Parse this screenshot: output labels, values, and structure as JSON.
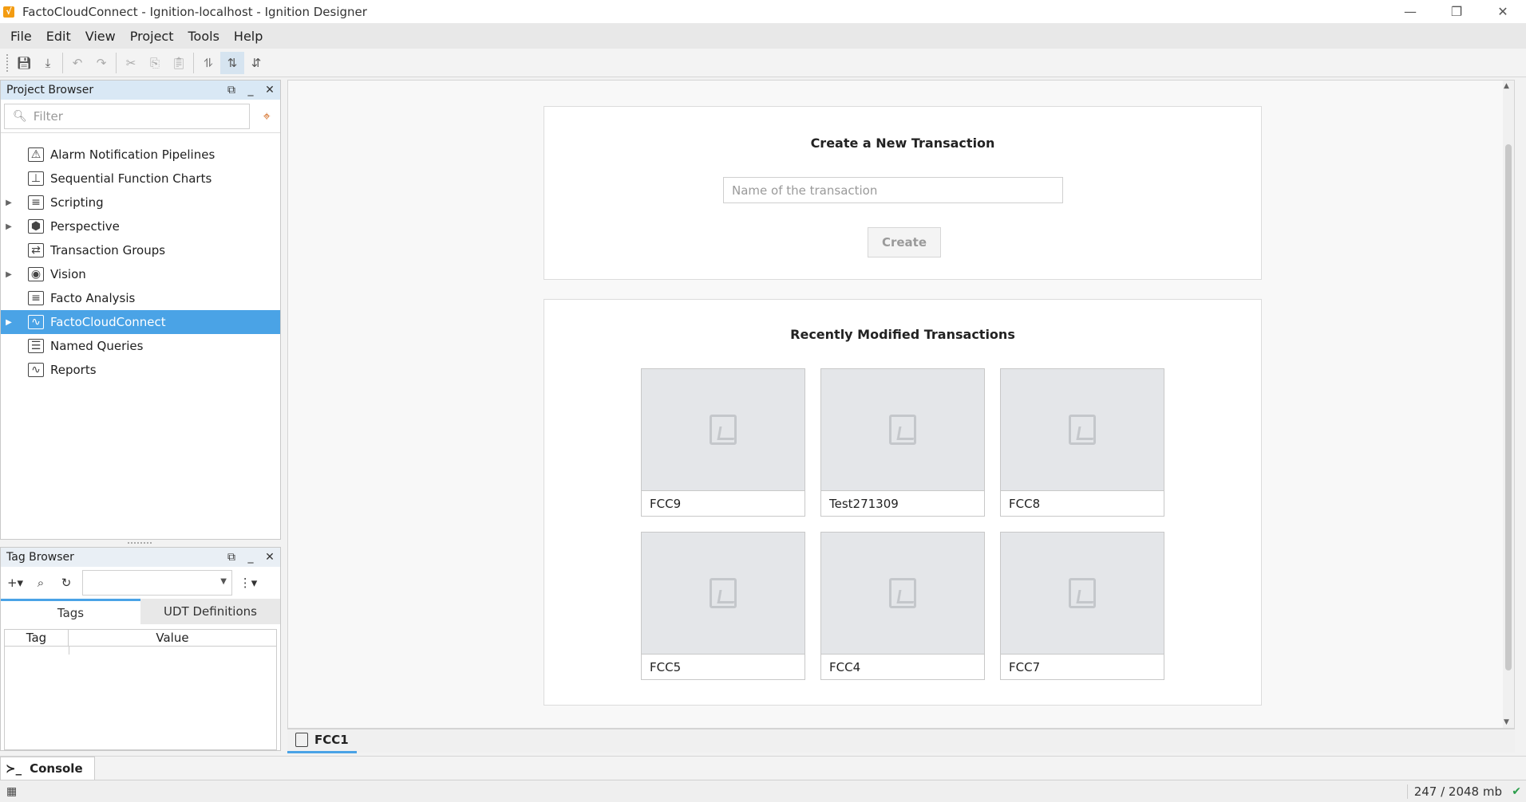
{
  "window": {
    "title": "FactoCloudConnect - Ignition-localhost - Ignition Designer",
    "app_icon": "ignition-icon",
    "controls": [
      "minimize",
      "restore",
      "close"
    ]
  },
  "menu": [
    "File",
    "Edit",
    "View",
    "Project",
    "Tools",
    "Help"
  ],
  "toolbar": {
    "buttons": [
      "save-icon",
      "save-all-icon",
      "undo-icon",
      "redo-icon",
      "cut-icon",
      "copy-icon",
      "paste-icon",
      "disconnect-icon",
      "comm-read-write-icon",
      "comm-read-only-icon"
    ]
  },
  "project_browser": {
    "title": "Project Browser",
    "filter_placeholder": "Filter",
    "items": [
      {
        "label": "Alarm Notification Pipelines",
        "expandable": false,
        "icon": "pipeline-icon"
      },
      {
        "label": "Sequential Function Charts",
        "expandable": false,
        "icon": "sfc-icon"
      },
      {
        "label": "Scripting",
        "expandable": true,
        "icon": "script-icon"
      },
      {
        "label": "Perspective",
        "expandable": true,
        "icon": "perspective-icon"
      },
      {
        "label": "Transaction Groups",
        "expandable": false,
        "icon": "transaction-groups-icon"
      },
      {
        "label": "Vision",
        "expandable": true,
        "icon": "vision-icon"
      },
      {
        "label": "Facto Analysis",
        "expandable": false,
        "icon": "document-icon"
      },
      {
        "label": "FactoCloudConnect",
        "expandable": true,
        "icon": "document-chart-icon",
        "selected": true
      },
      {
        "label": "Named Queries",
        "expandable": false,
        "icon": "named-queries-icon"
      },
      {
        "label": "Reports",
        "expandable": false,
        "icon": "report-icon"
      }
    ]
  },
  "tag_browser": {
    "title": "Tag Browser",
    "tabs": [
      "Tags",
      "UDT Definitions"
    ],
    "active_tab": "Tags",
    "columns": [
      "Tag",
      "Value"
    ]
  },
  "create_card": {
    "title": "Create a New Transaction",
    "input_placeholder": "Name of the transaction",
    "button_label": "Create"
  },
  "recent_card": {
    "title": "Recently Modified Transactions",
    "transactions": [
      "FCC9",
      "Test271309",
      "FCC8",
      "FCC5",
      "FCC4",
      "FCC7"
    ]
  },
  "doc_tab": {
    "label": "FCC1"
  },
  "console": {
    "label": "Console"
  },
  "status": {
    "memory": "247 / 2048 mb"
  },
  "colors": {
    "accent": "#4aa3e6",
    "selection": "#4aa3e6"
  }
}
